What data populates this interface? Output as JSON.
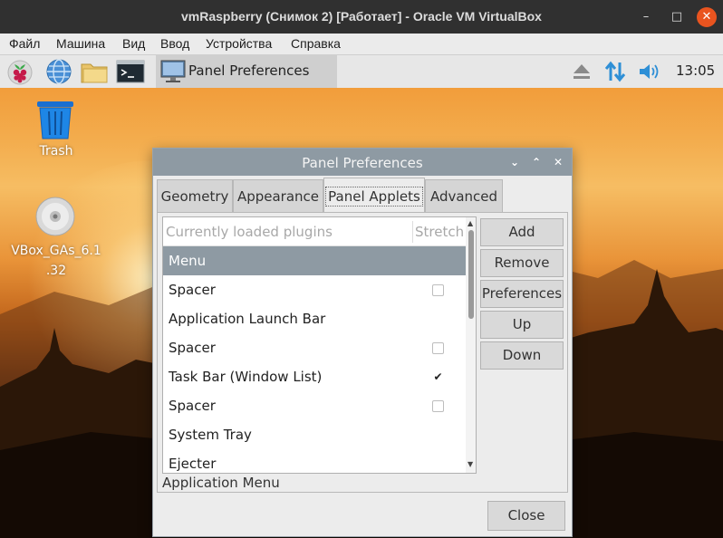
{
  "host_window": {
    "title": "vmRaspberry (Снимок 2) [Работает] - Oracle VM VirtualBox",
    "controls": {
      "minimize": "–",
      "maximize": "□",
      "close": "✕"
    }
  },
  "host_menu": [
    "Файл",
    "Машина",
    "Вид",
    "Ввод",
    "Устройства",
    "Справка"
  ],
  "guest_panel": {
    "launchers": [
      "raspberry-menu-icon",
      "web-browser-icon",
      "file-manager-icon",
      "terminal-icon"
    ],
    "taskbar_button": "Panel Preferences",
    "tray": [
      "eject-icon",
      "network-icon",
      "volume-icon"
    ],
    "clock": "13:05"
  },
  "desktop": {
    "icons": [
      {
        "name": "trash-icon",
        "label": "Trash"
      },
      {
        "name": "cd-icon",
        "label_line1": "VBox_GAs_6.1",
        "label_line2": ".32"
      }
    ]
  },
  "dialog": {
    "title": "Panel Preferences",
    "tabs": [
      "Geometry",
      "Appearance",
      "Panel Applets",
      "Advanced"
    ],
    "active_tab": "Panel Applets",
    "list_header": {
      "name": "Currently loaded plugins",
      "stretch": "Stretch"
    },
    "plugins": [
      {
        "name": "Menu",
        "stretch": null,
        "selected": true
      },
      {
        "name": "Spacer",
        "stretch": false
      },
      {
        "name": "Application Launch Bar",
        "stretch": null
      },
      {
        "name": "Spacer",
        "stretch": false
      },
      {
        "name": "Task Bar (Window List)",
        "stretch": true
      },
      {
        "name": "Spacer",
        "stretch": false
      },
      {
        "name": "System Tray",
        "stretch": null
      },
      {
        "name": "Ejecter",
        "stretch": null
      }
    ],
    "buttons": {
      "add": "Add",
      "remove": "Remove",
      "preferences": "Preferences",
      "up": "Up",
      "down": "Down"
    },
    "description": "Application Menu",
    "close": "Close",
    "controls": {
      "menu": "⌄",
      "maximize": "⌃",
      "close": "✕"
    }
  },
  "colors": {
    "dialog_titlebar": "#8e9aa3",
    "selection": "#8e9aa3",
    "host_close": "#e9541f",
    "tray_accent": "#2e8fd6"
  }
}
